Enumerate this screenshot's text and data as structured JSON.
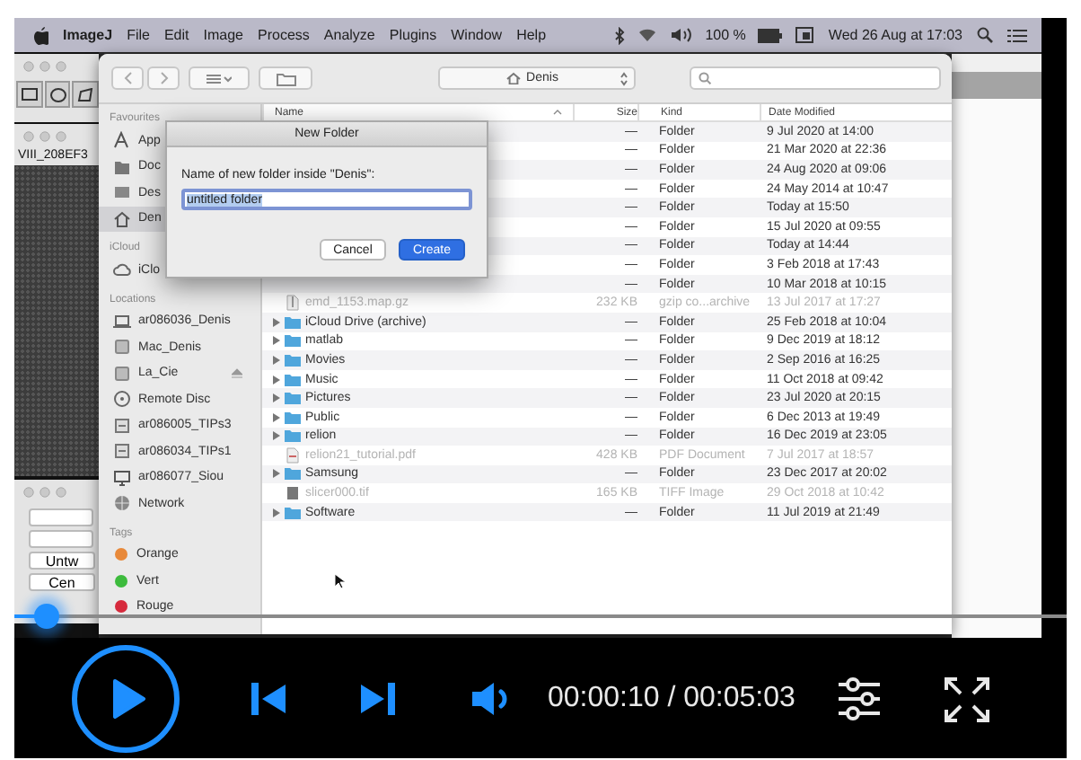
{
  "menu_bar": {
    "app_name": "ImageJ",
    "menus": [
      "File",
      "Edit",
      "Image",
      "Process",
      "Analyze",
      "Plugins",
      "Window",
      "Help"
    ],
    "battery": "100 %",
    "clock": "Wed 26 Aug at 17:03"
  },
  "imagej": {
    "image_title": "VIII_208EF3",
    "buttons": [
      "Untw",
      "Cen"
    ]
  },
  "finder": {
    "path": "Denis",
    "sidebar": [
      {
        "heading": "Favourites",
        "items": [
          {
            "label": "App",
            "kind": "applications",
            "selected": false
          },
          {
            "label": "Doc",
            "kind": "documents",
            "selected": false
          },
          {
            "label": "Des",
            "kind": "desktop",
            "selected": false
          },
          {
            "label": "Den",
            "kind": "home",
            "selected": true
          }
        ]
      },
      {
        "heading": "iCloud",
        "items": [
          {
            "label": "iClo",
            "kind": "cloud",
            "selected": false
          }
        ]
      },
      {
        "heading": "Locations",
        "items": [
          {
            "label": "ar086036_Denis",
            "kind": "laptop",
            "selected": false,
            "eject": false
          },
          {
            "label": "Mac_Denis",
            "kind": "disk",
            "selected": false,
            "eject": false
          },
          {
            "label": "La_Cie",
            "kind": "disk",
            "selected": false,
            "eject": true
          },
          {
            "label": "Remote Disc",
            "kind": "disc",
            "selected": false,
            "eject": false
          },
          {
            "label": "ar086005_TIPs3",
            "kind": "server",
            "selected": false,
            "eject": false
          },
          {
            "label": "ar086034_TIPs1",
            "kind": "server",
            "selected": false,
            "eject": false
          },
          {
            "label": "ar086077_Siou",
            "kind": "monitor",
            "selected": false,
            "eject": false
          },
          {
            "label": "Network",
            "kind": "network",
            "selected": false,
            "eject": false
          }
        ]
      },
      {
        "heading": "Tags",
        "items": [
          {
            "label": "Orange",
            "kind": "tag",
            "selected": false,
            "color": "#e8893a"
          },
          {
            "label": "Vert",
            "kind": "tag",
            "selected": false,
            "color": "#3dbb3d"
          },
          {
            "label": "Rouge",
            "kind": "tag",
            "selected": false,
            "color": "#d62a3c"
          }
        ]
      }
    ],
    "columns": [
      "Name",
      "Size",
      "Kind",
      "Date Modified"
    ],
    "rows": [
      {
        "size": "—",
        "type": "Folder",
        "date": "9 Jul 2020 at 14:00",
        "disabled": false
      },
      {
        "size": "—",
        "type": "Folder",
        "date": "21 Mar 2020 at 22:36",
        "disabled": false
      },
      {
        "size": "—",
        "type": "Folder",
        "date": "24 Aug 2020 at 09:06",
        "disabled": false
      },
      {
        "size": "—",
        "type": "Folder",
        "date": "24 May 2014 at 10:47",
        "disabled": false
      },
      {
        "size": "—",
        "type": "Folder",
        "date": "Today at 15:50",
        "disabled": false
      },
      {
        "size": "—",
        "type": "Folder",
        "date": "15 Jul 2020 at 09:55",
        "disabled": false
      },
      {
        "size": "—",
        "type": "Folder",
        "date": "Today at 14:44",
        "disabled": false
      },
      {
        "size": "—",
        "type": "Folder",
        "date": "3 Feb 2018 at 17:43",
        "disabled": false
      },
      {
        "size": "—",
        "type": "Folder",
        "date": "10 Mar 2018 at 10:15",
        "disabled": false
      },
      {
        "name": "emd_1153.map.gz",
        "kind": "archive",
        "size": "232 KB",
        "type": "gzip co...archive",
        "date": "13 Jul 2017 at 17:27",
        "disabled": true
      },
      {
        "name": "iCloud Drive (archive)",
        "kind": "folder",
        "size": "—",
        "type": "Folder",
        "date": "25 Feb 2018 at 10:04",
        "disabled": false
      },
      {
        "name": "matlab",
        "kind": "folder",
        "size": "—",
        "type": "Folder",
        "date": "9 Dec 2019 at 18:12",
        "disabled": false
      },
      {
        "name": "Movies",
        "kind": "folder",
        "size": "—",
        "type": "Folder",
        "date": "2 Sep 2016 at 16:25",
        "disabled": false
      },
      {
        "name": "Music",
        "kind": "folder",
        "size": "—",
        "type": "Folder",
        "date": "11 Oct 2018 at 09:42",
        "disabled": false
      },
      {
        "name": "Pictures",
        "kind": "folder",
        "size": "—",
        "type": "Folder",
        "date": "23 Jul 2020 at 20:15",
        "disabled": false
      },
      {
        "name": "Public",
        "kind": "folder",
        "size": "—",
        "type": "Folder",
        "date": "6 Dec 2013 at 19:49",
        "disabled": false
      },
      {
        "name": "relion",
        "kind": "folder",
        "size": "—",
        "type": "Folder",
        "date": "16 Dec 2019 at 23:05",
        "disabled": false
      },
      {
        "name": "relion21_tutorial.pdf",
        "kind": "pdf",
        "size": "428 KB",
        "type": "PDF Document",
        "date": "7 Jul 2017 at 18:57",
        "disabled": true
      },
      {
        "name": "Samsung",
        "kind": "folder",
        "size": "—",
        "type": "Folder",
        "date": "23 Dec 2017 at 20:02",
        "disabled": false
      },
      {
        "name": "slicer000.tif",
        "kind": "image",
        "size": "165 KB",
        "type": "TIFF Image",
        "date": "29 Oct 2018 at 10:42",
        "disabled": true
      },
      {
        "name": "Software",
        "kind": "folder",
        "size": "—",
        "type": "Folder",
        "date": "11 Jul 2019 at 21:49",
        "disabled": false
      }
    ]
  },
  "dialog": {
    "title": "New Folder",
    "prompt": "Name of new folder inside \"Denis\":",
    "value": "untitled folder",
    "buttons": [
      {
        "label": "Cancel",
        "kind": "secondary"
      },
      {
        "label": "Create",
        "kind": "primary"
      }
    ]
  },
  "player": {
    "level": 0.03,
    "time": "00:00:10 / 00:05:03"
  }
}
